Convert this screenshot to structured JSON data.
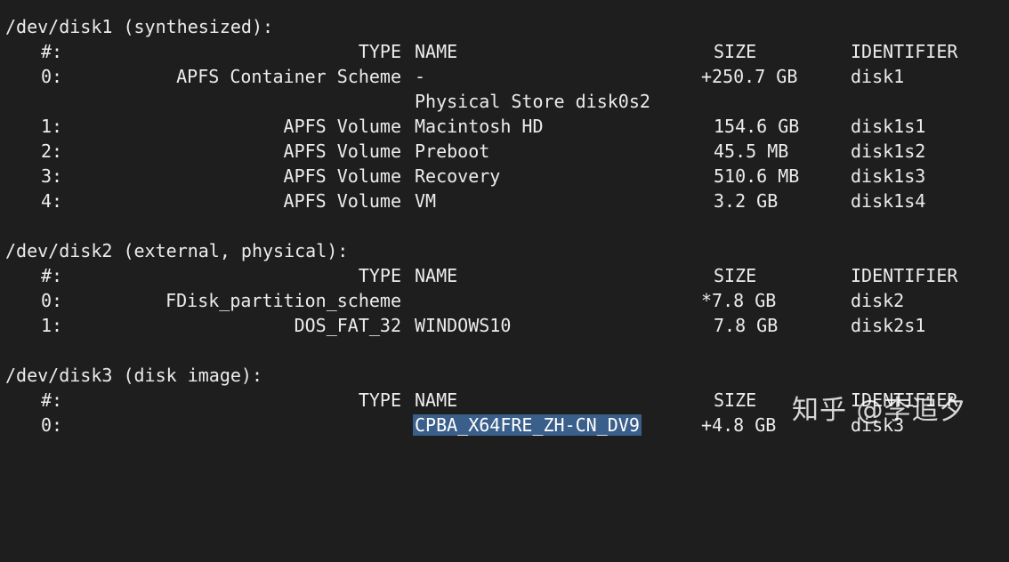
{
  "disk1": {
    "header": "/dev/disk1 (synthesized):",
    "columns": {
      "num": "#:",
      "type": "TYPE",
      "name": "NAME",
      "size": "SIZE",
      "identifier": "IDENTIFIER"
    },
    "rows": [
      {
        "num": "0:",
        "type": "APFS Container Scheme",
        "name": "-",
        "size": "+250.7 GB",
        "identifier": "disk1"
      },
      {
        "num": "",
        "type": "",
        "name": "Physical Store disk0s2",
        "size": "",
        "identifier": ""
      },
      {
        "num": "1:",
        "type": "APFS Volume",
        "name": "Macintosh HD",
        "size": "154.6 GB",
        "identifier": "disk1s1"
      },
      {
        "num": "2:",
        "type": "APFS Volume",
        "name": "Preboot",
        "size": "45.5 MB",
        "identifier": "disk1s2"
      },
      {
        "num": "3:",
        "type": "APFS Volume",
        "name": "Recovery",
        "size": "510.6 MB",
        "identifier": "disk1s3"
      },
      {
        "num": "4:",
        "type": "APFS Volume",
        "name": "VM",
        "size": "3.2 GB",
        "identifier": "disk1s4"
      }
    ]
  },
  "disk2": {
    "header": "/dev/disk2 (external, physical):",
    "columns": {
      "num": "#:",
      "type": "TYPE",
      "name": "NAME",
      "size": "SIZE",
      "identifier": "IDENTIFIER"
    },
    "rows": [
      {
        "num": "0:",
        "type": "FDisk_partition_scheme",
        "name": "",
        "size": "*7.8 GB",
        "identifier": "disk2"
      },
      {
        "num": "1:",
        "type": "DOS_FAT_32",
        "name": "WINDOWS10",
        "size": "7.8 GB",
        "identifier": "disk2s1"
      }
    ]
  },
  "disk3": {
    "header": "/dev/disk3 (disk image):",
    "columns": {
      "num": "#:",
      "type": "TYPE",
      "name": "NAME",
      "size": "SIZE",
      "identifier": "IDENTIFIER"
    },
    "rows": [
      {
        "num": "0:",
        "type": "",
        "name": "CPBA_X64FRE_ZH-CN_DV9",
        "size": "+4.8 GB",
        "identifier": "disk3"
      }
    ]
  },
  "watermark": "知乎 @李追夕",
  "colors": {
    "background": "#1e1e1e",
    "text": "#ececec",
    "selection": "#3a5f8a"
  }
}
